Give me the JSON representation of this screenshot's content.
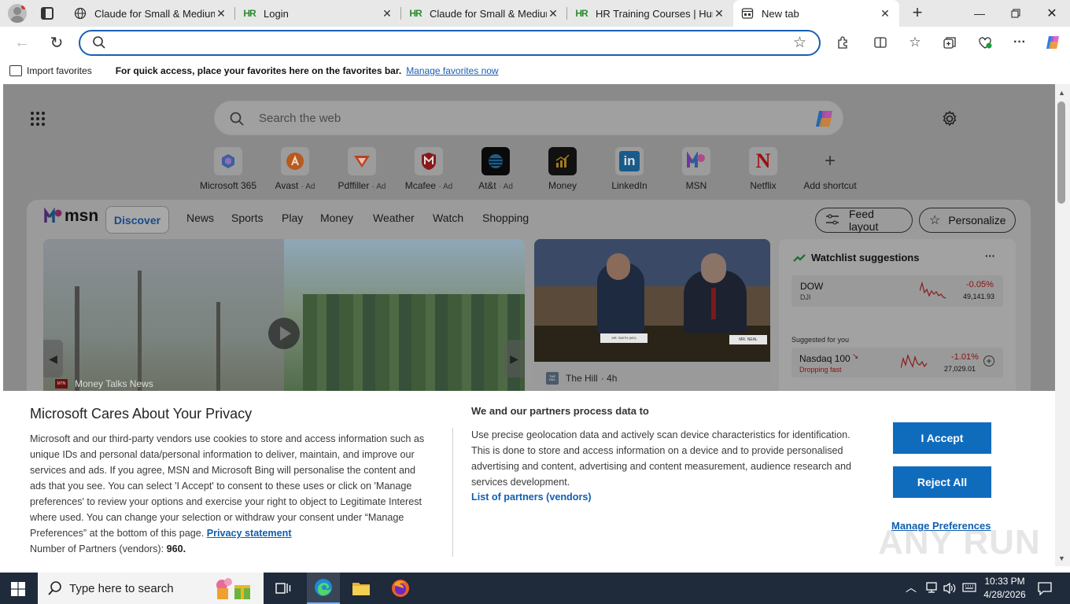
{
  "tabs": [
    {
      "title": "Claude for Small & Medium",
      "icon": "globe-icon"
    },
    {
      "title": "Login",
      "icon": "hr-icon"
    },
    {
      "title": "Claude for Small & Medium",
      "icon": "hr-icon"
    },
    {
      "title": "HR Training Courses | Huma",
      "icon": "hr-icon"
    },
    {
      "title": "New tab",
      "icon": "newtab-icon"
    }
  ],
  "favorites_bar": {
    "import_label": "Import favorites",
    "message": "For quick access, place your favorites here on the favorites bar.",
    "manage_link": "Manage favorites now"
  },
  "search": {
    "placeholder": "Search the web"
  },
  "shortcuts": [
    {
      "label": "Microsoft 365",
      "ad": ""
    },
    {
      "label": "Avast",
      "ad": "· Ad"
    },
    {
      "label": "Pdffiller",
      "ad": "· Ad"
    },
    {
      "label": "Mcafee",
      "ad": "· Ad"
    },
    {
      "label": "At&t",
      "ad": "· Ad"
    },
    {
      "label": "Money",
      "ad": ""
    },
    {
      "label": "LinkedIn",
      "ad": ""
    },
    {
      "label": "MSN",
      "ad": ""
    },
    {
      "label": "Netflix",
      "ad": ""
    },
    {
      "label": "Add shortcut",
      "ad": ""
    }
  ],
  "msn": {
    "logo": "msn",
    "nav": [
      "Discover",
      "News",
      "Sports",
      "Play",
      "Money",
      "Weather",
      "Watch",
      "Shopping"
    ],
    "feed_layout": "Feed layout",
    "personalize": "Personalize",
    "hero_source": "Money Talks News",
    "hero_source_badge": "MTN",
    "card2_source": "The Hill",
    "card2_age": "· 4h",
    "card2_source_badge": "THE HILL",
    "nameplate_left": "MR. SMITH (MO)",
    "nameplate_right": "MR. NEAL"
  },
  "watchlist": {
    "title": "Watchlist suggestions",
    "more": "···",
    "items": [
      {
        "name": "DOW",
        "sub": "DJI",
        "change": "-0.05%",
        "value": "49,141.93"
      },
      {
        "name": "Nasdaq 100",
        "sub": "Dropping fast",
        "change": "-1.01%",
        "value": "27,029.01"
      }
    ],
    "suggested_label": "Suggested for you",
    "add": "+"
  },
  "consent": {
    "title": "Microsoft Cares About Your Privacy",
    "body": "Microsoft and our third-party vendors use cookies to store and access information such as unique IDs and personal data/personal information to deliver, maintain, and improve our services and ads. If you agree, MSN and Microsoft Bing will personalise the content and ads that you see. You can select 'I Accept' to consent to these uses or click on 'Manage preferences' to review your options and exercise your right to object to Legitimate Interest where used. You can change your selection or withdraw your consent under “Manage Preferences” at the bottom of this page.",
    "privacy_link": "Privacy statement",
    "partners_label": "Number of Partners (vendors):",
    "partners_count": "960.",
    "right_title": "We and our partners process data to",
    "right_body": "Use precise geolocation data and actively scan device characteristics for identification. This is done to store and access information on a device and to provide personalised advertising and content, advertising and content measurement, audience research and services development.",
    "partners_link": "List of partners (vendors)",
    "accept": "I Accept",
    "reject": "Reject All",
    "manage": "Manage Preferences"
  },
  "watermark": "ANY RUN",
  "taskbar": {
    "search_placeholder": "Type here to search",
    "time": "10:33 PM",
    "date": "4/28/2026"
  },
  "colors": {
    "accent": "#0f6cbd",
    "address_border": "#1a5fb4",
    "taskbar": "#1f2a3a",
    "stock_red": "#d13438"
  }
}
